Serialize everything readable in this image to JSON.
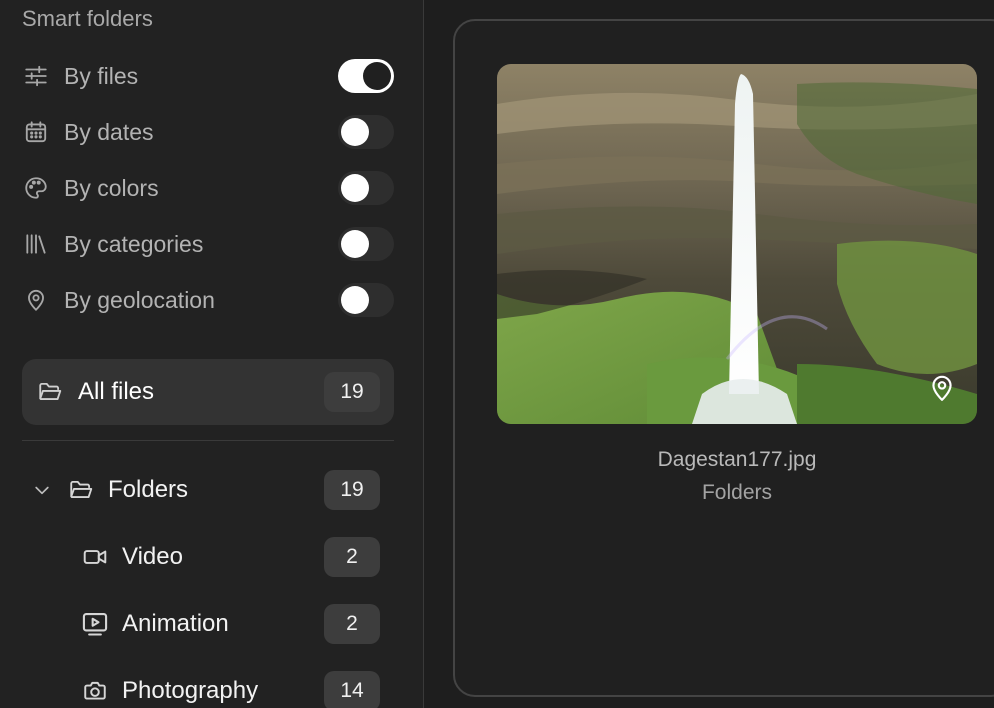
{
  "sidebar": {
    "section_title": "Smart folders",
    "smart_folders": [
      {
        "label": "By files",
        "icon": "sliders-icon",
        "enabled": true
      },
      {
        "label": "By dates",
        "icon": "calendar-icon",
        "enabled": false
      },
      {
        "label": "By colors",
        "icon": "palette-icon",
        "enabled": false
      },
      {
        "label": "By categories",
        "icon": "library-icon",
        "enabled": false
      },
      {
        "label": "By geolocation",
        "icon": "location-pin-icon",
        "enabled": false
      }
    ],
    "all_files": {
      "label": "All files",
      "count": "19",
      "icon": "folder-open-icon"
    },
    "tree": {
      "root": {
        "label": "Folders",
        "count": "19",
        "icon": "folder-open-icon",
        "expanded": true
      },
      "children": [
        {
          "label": "Video",
          "count": "2",
          "icon": "video-camera-icon"
        },
        {
          "label": "Animation",
          "count": "2",
          "icon": "monitor-play-icon"
        },
        {
          "label": "Photography",
          "count": "14",
          "icon": "camera-icon"
        }
      ]
    }
  },
  "content": {
    "card": {
      "filename": "Dagestan177.jpg",
      "folder": "Folders",
      "badge_icon": "location-pin-icon"
    }
  },
  "colors": {
    "background": "#1e1e1e",
    "sidebar": "#222222",
    "selected_row": "#333333",
    "badge": "#3d3d3d",
    "toggle_on": "#ffffff"
  }
}
